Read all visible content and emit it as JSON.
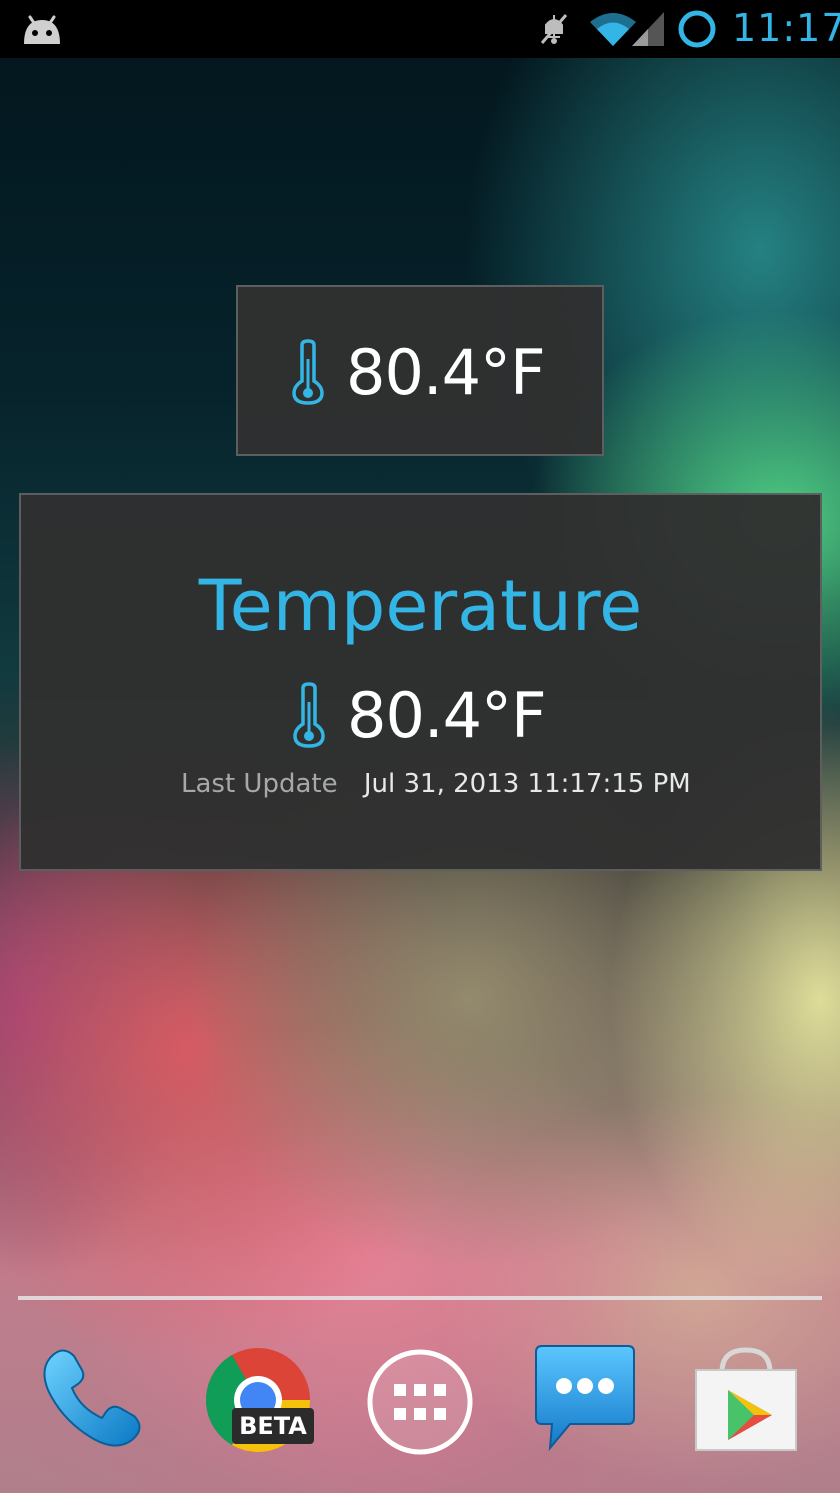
{
  "status_bar": {
    "time": "11:17",
    "icons": [
      "android-notification-icon",
      "mute-icon",
      "wifi-icon",
      "signal-icon",
      "circle-indicator-icon"
    ],
    "accent_color": "#33b5e5"
  },
  "widget_small": {
    "temperature": "80.4°F",
    "icon": "thermometer-icon"
  },
  "widget_large": {
    "title": "Temperature",
    "temperature": "80.4°F",
    "icon": "thermometer-icon",
    "last_update_label": "Last Update",
    "last_update_value": "Jul 31, 2013 11:17:15 PM"
  },
  "dock": {
    "apps": [
      {
        "name": "phone",
        "icon": "phone-icon"
      },
      {
        "name": "chrome-beta",
        "icon": "chrome-beta-icon",
        "badge": "BETA"
      },
      {
        "name": "app-drawer",
        "icon": "app-drawer-icon"
      },
      {
        "name": "messaging",
        "icon": "messaging-icon"
      },
      {
        "name": "play-store",
        "icon": "play-store-icon"
      }
    ]
  },
  "colors": {
    "accent": "#33b5e5",
    "widget_bg": "#303030",
    "secondary_text": "#a8a8a8"
  }
}
